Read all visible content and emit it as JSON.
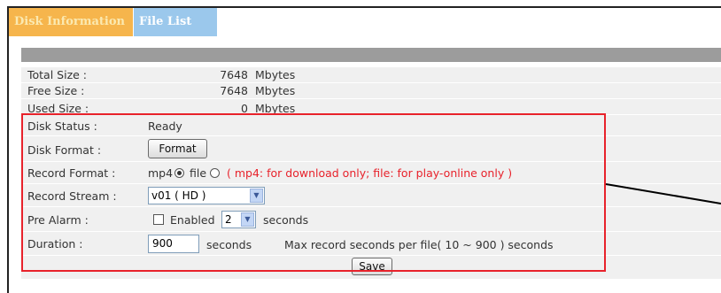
{
  "tabs": {
    "disk_information": "Disk Information",
    "file_list": "File List"
  },
  "info": {
    "total_label": "Total Size :",
    "total_value": "7648",
    "total_unit": "Mbytes",
    "free_label": "Free Size :",
    "free_value": "7648",
    "free_unit": "Mbytes",
    "used_label": "Used Size :",
    "used_value": "0",
    "used_unit": "Mbytes"
  },
  "settings": {
    "status_label": "Disk Status :",
    "status_value": "Ready",
    "format_label": "Disk Format :",
    "format_button": "Format",
    "record_format_label": "Record Format :",
    "opt_mp4": "mp4",
    "opt_file": "file",
    "record_format_selected": "mp4",
    "record_format_note": "( mp4: for download only; file: for play-online only )",
    "stream_label": "Record Stream :",
    "stream_value": "v01 ( HD )",
    "prealarm_label": "Pre Alarm :",
    "prealarm_enabled_label": "Enabled",
    "prealarm_seconds_value": "2",
    "prealarm_unit": "seconds",
    "duration_label": "Duration :",
    "duration_value": "900",
    "duration_unit": "seconds",
    "duration_note": "Max record seconds per file( 10 ~ 900 ) seconds"
  },
  "actions": {
    "save_button": "Save"
  },
  "colors": {
    "tab_active_bg": "#f6b54c",
    "tab_inactive_bg": "#9bc8ec",
    "highlight_box": "#e8222b",
    "header_bar": "#9c9c9c"
  }
}
